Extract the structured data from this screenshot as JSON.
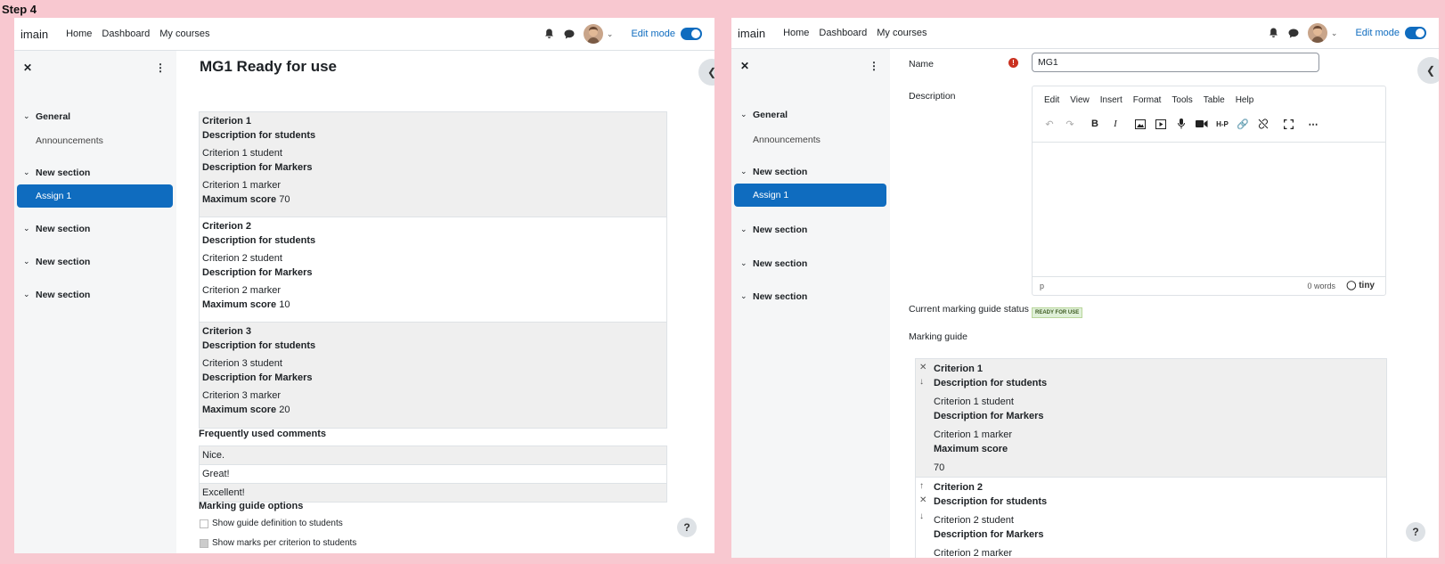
{
  "step_label": "Step 4",
  "navbar": {
    "brand": "imain",
    "links": [
      "Home",
      "Dashboard",
      "My courses"
    ],
    "edit_mode_label": "Edit mode"
  },
  "drawer": {
    "sections": [
      {
        "title": "General",
        "items": [
          "Announcements"
        ]
      },
      {
        "title": "New section",
        "items": [
          "Assign 1"
        ]
      },
      {
        "title": "New section",
        "items": []
      },
      {
        "title": "New section",
        "items": []
      },
      {
        "title": "New section",
        "items": []
      }
    ],
    "active_item": "Assign 1"
  },
  "left": {
    "title": "MG1 Ready for use",
    "criteria": [
      {
        "name": "Criterion 1",
        "desc_students_label": "Description for students",
        "desc_students": "Criterion 1 student",
        "desc_markers_label": "Description for Markers",
        "desc_markers": "Criterion 1 marker",
        "max_label": "Maximum score",
        "max": "70"
      },
      {
        "name": "Criterion 2",
        "desc_students_label": "Description for students",
        "desc_students": "Criterion 2 student",
        "desc_markers_label": "Description for Markers",
        "desc_markers": "Criterion 2 marker",
        "max_label": "Maximum score",
        "max": "10"
      },
      {
        "name": "Criterion 3",
        "desc_students_label": "Description for students",
        "desc_students": "Criterion 3 student",
        "desc_markers_label": "Description for Markers",
        "desc_markers": "Criterion 3 marker",
        "max_label": "Maximum score",
        "max": "20"
      }
    ],
    "comments_heading": "Frequently used comments",
    "comments": [
      "Nice.",
      "Great!",
      "Excellent!"
    ],
    "options_heading": "Marking guide options",
    "options": [
      {
        "label": "Show guide definition to students",
        "checked": false
      },
      {
        "label": "Show marks per criterion to students",
        "checked": true
      }
    ]
  },
  "right": {
    "name_label": "Name",
    "name_value": "MG1",
    "description_label": "Description",
    "editor_menu": [
      "Edit",
      "View",
      "Insert",
      "Format",
      "Tools",
      "Table",
      "Help"
    ],
    "editor_status_tag": "p",
    "editor_word_count": "0 words",
    "editor_brand": "tiny",
    "guide_status_label": "Current marking guide status",
    "guide_status_value": "READY FOR USE",
    "marking_guide_label": "Marking guide",
    "criteria": [
      {
        "name": "Criterion 1",
        "desc_students_label": "Description for students",
        "desc_students": "Criterion 1 student",
        "desc_markers_label": "Description for Markers",
        "desc_markers": "Criterion 1 marker",
        "max_label": "Maximum score",
        "max": "70"
      },
      {
        "name": "Criterion 2",
        "desc_students_label": "Description for students",
        "desc_students": "Criterion 2 student",
        "desc_markers_label": "Description for Markers",
        "desc_markers": "Criterion 2 marker"
      }
    ]
  },
  "help_symbol": "?",
  "colors": {
    "primary": "#0f6cbf",
    "background": "#f8c8d0",
    "required": "#ca3120"
  }
}
